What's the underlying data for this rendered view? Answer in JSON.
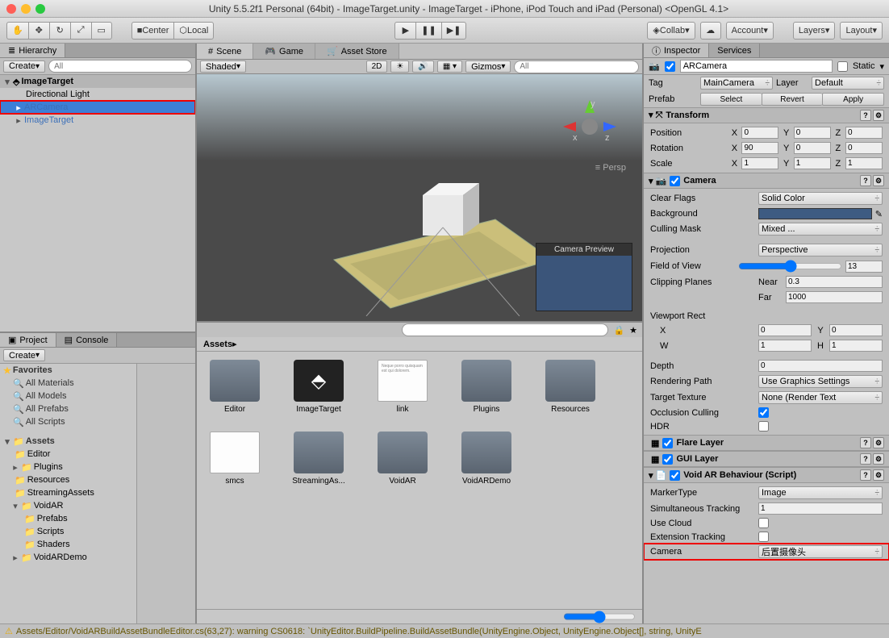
{
  "title": "Unity 5.5.2f1 Personal (64bit) - ImageTarget.unity - ImageTarget - iPhone, iPod Touch and iPad (Personal) <OpenGL 4.1>",
  "toolbar": {
    "center": "Center",
    "local": "Local",
    "collab": "Collab",
    "account": "Account",
    "layers": "Layers",
    "layout": "Layout"
  },
  "hierarchy": {
    "tab": "Hierarchy",
    "create": "Create",
    "search_ph": "All",
    "root": "ImageTarget",
    "items": [
      "Directional Light",
      "ARCamera",
      "ImageTarget"
    ]
  },
  "scene": {
    "tabs": [
      "Scene",
      "Game",
      "Asset Store"
    ],
    "shaded": "Shaded",
    "twod": "2D",
    "gizmos": "Gizmos",
    "search_ph": "All",
    "persp": "Persp",
    "cam_preview": "Camera Preview",
    "axes": {
      "x": "x",
      "y": "y",
      "z": "z"
    }
  },
  "project": {
    "tabs": [
      "Project",
      "Console"
    ],
    "create": "Create",
    "crumb": "Assets",
    "favorites_head": "Favorites",
    "favorites": [
      "All Materials",
      "All Models",
      "All Prefabs",
      "All Scripts"
    ],
    "assets_head": "Assets",
    "tree": [
      "Editor",
      "Plugins",
      "Resources",
      "StreamingAssets",
      "VoidAR",
      "Prefabs",
      "Scripts",
      "Shaders",
      "VoidARDemo"
    ],
    "grid": [
      "Editor",
      "ImageTarget",
      "link",
      "Plugins",
      "Resources",
      "smcs",
      "StreamingAs...",
      "VoidAR",
      "VoidARDemo"
    ]
  },
  "inspector": {
    "tab_inspector": "Inspector",
    "tab_services": "Services",
    "name": "ARCamera",
    "static": "Static",
    "tag_label": "Tag",
    "tag": "MainCamera",
    "layer_label": "Layer",
    "layer": "Default",
    "prefab_label": "Prefab",
    "prefab_select": "Select",
    "prefab_revert": "Revert",
    "prefab_apply": "Apply",
    "transform": {
      "head": "Transform",
      "position": "Position",
      "pos": {
        "x": "0",
        "y": "0",
        "z": "0"
      },
      "rotation": "Rotation",
      "rot": {
        "x": "90",
        "y": "0",
        "z": "0"
      },
      "scale": "Scale",
      "scl": {
        "x": "1",
        "y": "1",
        "z": "1"
      }
    },
    "camera": {
      "head": "Camera",
      "clear_flags": "Clear Flags",
      "clear_flags_v": "Solid Color",
      "background": "Background",
      "culling": "Culling Mask",
      "culling_v": "Mixed ...",
      "projection": "Projection",
      "projection_v": "Perspective",
      "fov": "Field of View",
      "fov_v": "13",
      "clip": "Clipping Planes",
      "near_l": "Near",
      "near": "0.3",
      "far_l": "Far",
      "far": "1000",
      "viewport": "Viewport Rect",
      "vx": "0",
      "vy": "0",
      "vw": "1",
      "vh": "1",
      "depth": "Depth",
      "depth_v": "0",
      "render_path": "Rendering Path",
      "render_path_v": "Use Graphics Settings",
      "target_tex": "Target Texture",
      "target_tex_v": "None (Render Text",
      "occ": "Occlusion Culling",
      "hdr": "HDR"
    },
    "flare": "Flare Layer",
    "gui": "GUI Layer",
    "voidar": {
      "head": "Void AR Behaviour (Script)",
      "marker": "MarkerType",
      "marker_v": "Image",
      "sim": "Simultaneous Tracking",
      "sim_v": "1",
      "cloud": "Use Cloud",
      "ext": "Extension Tracking",
      "camera": "Camera",
      "camera_v": "后置摄像头"
    }
  },
  "status": "Assets/Editor/VoidARBuildAssetBundleEditor.cs(63,27): warning CS0618: `UnityEditor.BuildPipeline.BuildAssetBundle(UnityEngine.Object, UnityEngine.Object[], string, UnityE"
}
